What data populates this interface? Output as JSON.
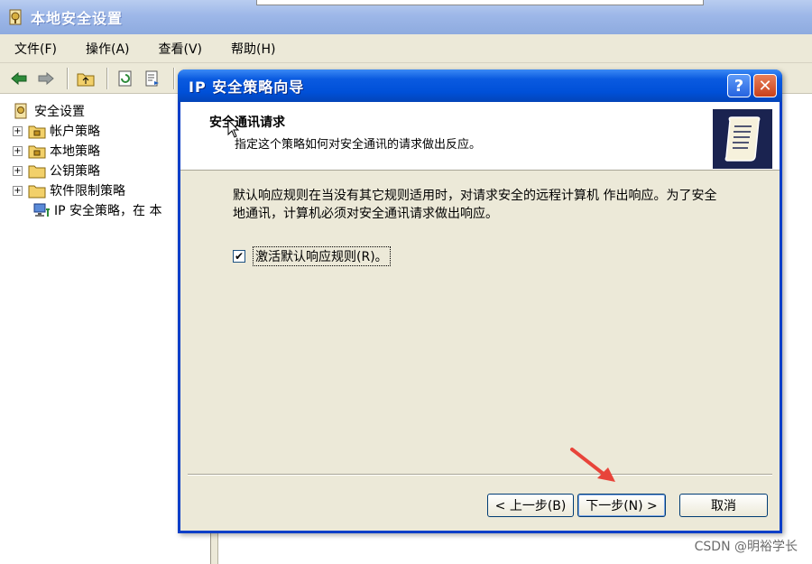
{
  "main_window": {
    "title": "本地安全设置",
    "menus": [
      "文件(F)",
      "操作(A)",
      "查看(V)",
      "帮助(H)"
    ],
    "tree": [
      {
        "label": "安全设置",
        "expander": ""
      },
      {
        "label": "帐户策略",
        "expander": "+"
      },
      {
        "label": "本地策略",
        "expander": "+"
      },
      {
        "label": "公钥策略",
        "expander": "+"
      },
      {
        "label": "软件限制策略",
        "expander": "+"
      },
      {
        "label": "IP 安全策略，在 本",
        "expander": ""
      }
    ]
  },
  "dialog": {
    "title": "IP 安全策略向导",
    "help_glyph": "?",
    "close_glyph": "✕",
    "heading": "安全通讯请求",
    "subheading": "指定这个策略如何对安全通讯的请求做出反应。",
    "body": "默认响应规则在当没有其它规则适用时，对请求安全的远程计算机 作出响应。为了安全地通讯，计算机必须对安全通讯请求做出响应。",
    "checkbox": {
      "label": "激活默认响应规则(R)。",
      "checked": true,
      "mark": "✔"
    },
    "buttons": {
      "back": "< 上一步(B)",
      "next": "下一步(N) >",
      "cancel": "取消"
    }
  },
  "watermark": "CSDN @明裕学长",
  "colors": {
    "dialog_title": "#0050d8",
    "arrow": "#e8443a"
  }
}
